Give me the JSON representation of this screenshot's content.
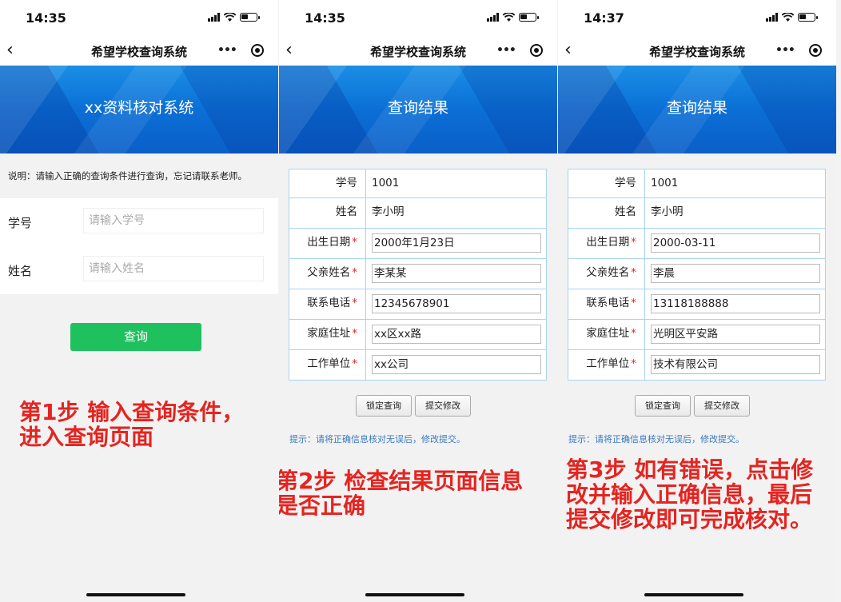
{
  "panels": [
    {
      "time": "14:35",
      "nav_title": "希望学校查询系统",
      "banner_title": "xx资料核对系统",
      "description": "说明：请输入正确的查询条件进行查询，忘记请联系老师。",
      "fields": [
        {
          "label": "学号",
          "placeholder": "请输入学号"
        },
        {
          "label": "姓名",
          "placeholder": "请输入姓名"
        }
      ],
      "query_button": "查询",
      "caption": [
        "第1步 输入查询条件，",
        "进入查询页面"
      ]
    },
    {
      "time": "14:35",
      "nav_title": "希望学校查询系统",
      "banner_title": "查询结果",
      "rows": [
        {
          "label": "学号",
          "value": "1001",
          "required": false
        },
        {
          "label": "姓名",
          "value": "李小明",
          "required": false
        },
        {
          "label": "出生日期",
          "value": "2000年1月23日",
          "required": true
        },
        {
          "label": "父亲姓名",
          "value": "李某某",
          "required": true
        },
        {
          "label": "联系电话",
          "value": "12345678901",
          "required": true
        },
        {
          "label": "家庭住址",
          "value": "xx区xx路",
          "required": true
        },
        {
          "label": "工作单位",
          "value": "xx公司",
          "required": true
        }
      ],
      "lock_button": "锁定查询",
      "submit_button": "提交修改",
      "hint": "提示：请将正确信息核对无误后，修改提交。",
      "caption": [
        "第2步 检查结果页面信息",
        "是否正确"
      ]
    },
    {
      "time": "14:37",
      "nav_title": "希望学校查询系统",
      "banner_title": "查询结果",
      "rows": [
        {
          "label": "学号",
          "value": "1001",
          "required": false
        },
        {
          "label": "姓名",
          "value": "李小明",
          "required": false
        },
        {
          "label": "出生日期",
          "value": "2000-03-11",
          "required": true
        },
        {
          "label": "父亲姓名",
          "value": "李晨",
          "required": true
        },
        {
          "label": "联系电话",
          "value": "13118188888",
          "required": true
        },
        {
          "label": "家庭住址",
          "value": "光明区平安路",
          "required": true
        },
        {
          "label": "工作单位",
          "value": "技术有限公司",
          "required": true
        }
      ],
      "lock_button": "锁定查询",
      "submit_button": "提交修改",
      "hint": "提示：请将正确信息核对无误后，修改提交。",
      "caption": [
        "第3步 如有错误，点击修",
        "改并输入正确信息，最后",
        "提交修改即可完成核对。"
      ]
    }
  ],
  "required_mark": "*",
  "colors": {
    "accent_green": "#1ec15d",
    "caption_red": "#e52420",
    "banner_blue": "#0b6fd6",
    "hint_blue": "#3a78c0"
  }
}
